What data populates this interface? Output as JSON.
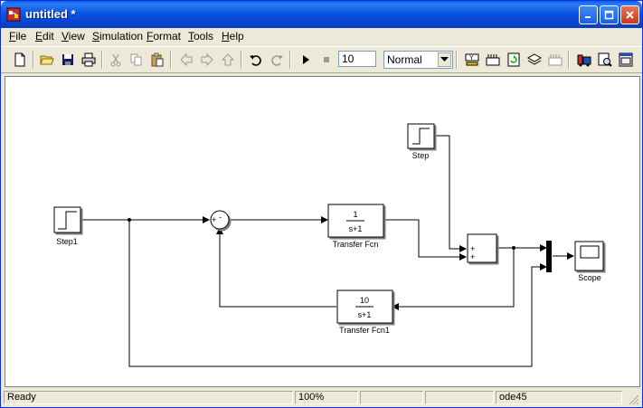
{
  "window": {
    "title": "untitled *"
  },
  "menu": [
    "File",
    "Edit",
    "View",
    "Simulation",
    "Format",
    "Tools",
    "Help"
  ],
  "toolbar": {
    "stop_time": "10",
    "sim_mode": "Normal"
  },
  "blocks": {
    "step": "Step",
    "step1": "Step1",
    "tf": {
      "label": "Transfer Fcn",
      "num": "1",
      "den": "s+1"
    },
    "tf1": {
      "label": "Transfer Fcn1",
      "num": "10",
      "den": "s+1"
    },
    "scope": "Scope",
    "sum1_signs": [
      "+",
      "-"
    ],
    "sum2_signs": [
      "+",
      "+"
    ]
  },
  "status": {
    "ready": "Ready",
    "zoom": "100%",
    "solver": "ode45"
  }
}
